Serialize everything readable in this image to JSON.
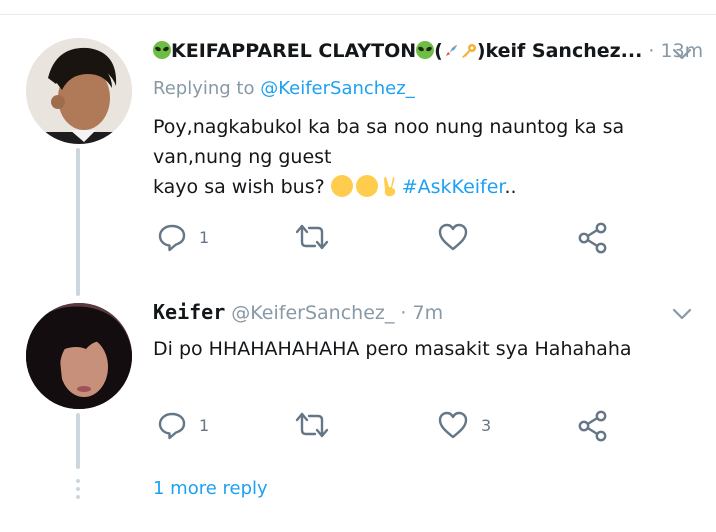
{
  "tweet1": {
    "display_name": "KEIFAPPAREL CLAYTON",
    "name_suffix": "(",
    "name_tail": ")keif Sanchez...",
    "separator": "·",
    "time": "13m",
    "replying_prefix": "Replying to",
    "replying_handle": "@KeiferSanchez_",
    "text_line1": "Poy,nagkabukol ka ba sa noo nung nauntog ka sa van,nung ng guest",
    "text_line2": "kayo sa wish bus?",
    "hashtag": "#AskKeifer",
    "text_tail": "..",
    "actions": {
      "reply_count": "1",
      "retweet_count": "",
      "like_count": ""
    }
  },
  "tweet2": {
    "display_name": "Keifer",
    "handle": "@KeiferSanchez_",
    "separator": "·",
    "time": "7m",
    "text": "Di po HHAHAHAHAHA pero masakit sya Hahahaha",
    "actions": {
      "reply_count": "1",
      "retweet_count": "",
      "like_count": "3"
    }
  },
  "more_replies": "1 more reply",
  "colors": {
    "accent": "#1da1f2",
    "muted": "#8899a6",
    "icon": "#657786",
    "line": "#ccd6dd"
  }
}
